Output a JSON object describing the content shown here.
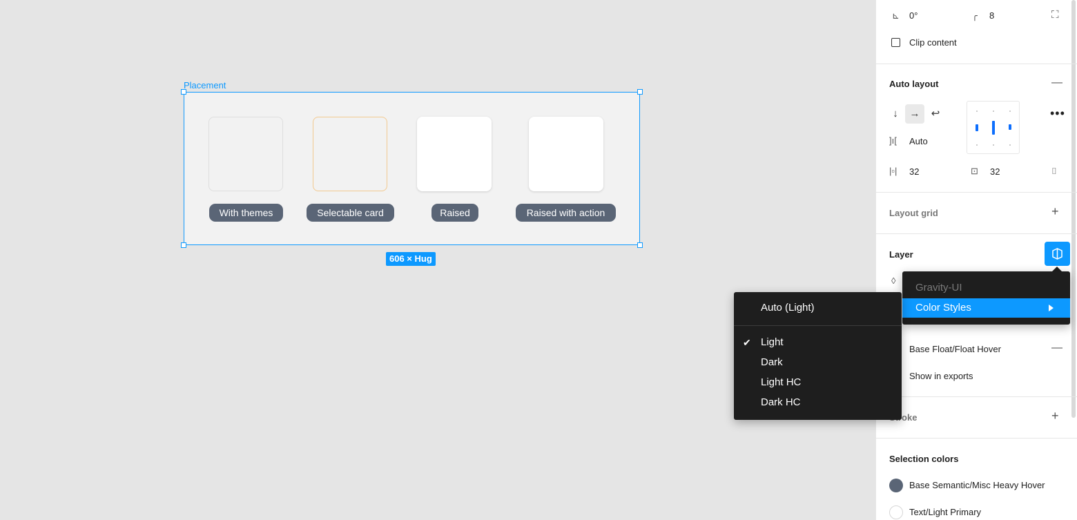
{
  "canvas": {
    "frame_label": "Placement",
    "size_badge": "606 × Hug",
    "cards": [
      {
        "label": "With themes"
      },
      {
        "label": "Selectable card"
      },
      {
        "label": "Raised"
      },
      {
        "label": "Raised with action"
      }
    ]
  },
  "panel": {
    "rotation": "0°",
    "corner_radius": "8",
    "clip_content": "Clip content",
    "auto_layout": {
      "title": "Auto layout",
      "gap": "Auto",
      "padding_horizontal": "32",
      "padding_vertical": "32"
    },
    "layout_grid": "Layout grid",
    "layer": "Layer",
    "fill_style": "Base Float/Float Hover",
    "show_in_exports": "Show in exports",
    "stroke": "Stroke",
    "selection_colors": {
      "title": "Selection colors",
      "items": [
        {
          "name": "Base Semantic/Misc Heavy Hover",
          "color": "#5a6576"
        },
        {
          "name": "Text/Light Primary",
          "color": "#ffffff"
        }
      ]
    }
  },
  "library_menu": {
    "header": "Gravity-UI",
    "item": "Color Styles"
  },
  "mode_menu": {
    "auto": "Auto (Light)",
    "options": [
      "Light",
      "Dark",
      "Light HC",
      "Dark HC"
    ],
    "selected": "Light"
  },
  "colors": {
    "accent": "#0d99ff",
    "pill": "#5a6576",
    "menu_bg": "#1e1e1e"
  }
}
